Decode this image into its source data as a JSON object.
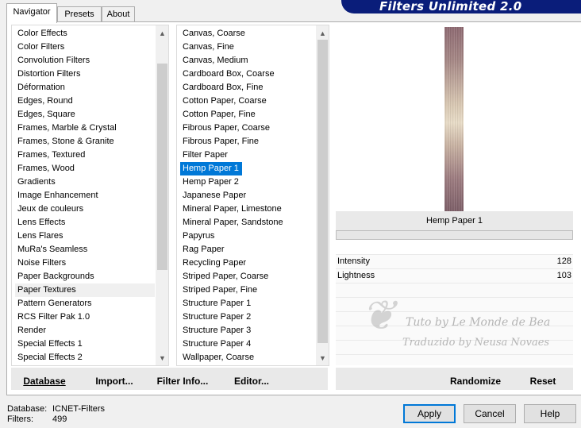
{
  "banner_title": "Filters Unlimited 2.0",
  "tabs": [
    {
      "label": "Navigator",
      "active": true
    },
    {
      "label": "Presets",
      "active": false
    },
    {
      "label": "About",
      "active": false
    }
  ],
  "categories": [
    "Color Effects",
    "Color Filters",
    "Convolution Filters",
    "Distortion Filters",
    "Déformation",
    "Edges, Round",
    "Edges, Square",
    "Frames, Marble & Crystal",
    "Frames, Stone & Granite",
    "Frames, Textured",
    "Frames, Wood",
    "Gradients",
    "Image Enhancement",
    "Jeux de couleurs",
    "Lens Effects",
    "Lens Flares",
    "MuRa's Seamless",
    "Noise Filters",
    "Paper Backgrounds",
    "Paper Textures",
    "Pattern Generators",
    "RCS Filter Pak 1.0",
    "Render",
    "Special Effects 1",
    "Special Effects 2"
  ],
  "categories_selected": "Paper Textures",
  "filters": [
    "Canvas, Coarse",
    "Canvas, Fine",
    "Canvas, Medium",
    "Cardboard Box, Coarse",
    "Cardboard Box, Fine",
    "Cotton Paper, Coarse",
    "Cotton Paper, Fine",
    "Fibrous Paper, Coarse",
    "Fibrous Paper, Fine",
    "Filter Paper",
    "Hemp Paper 1",
    "Hemp Paper 2",
    "Japanese Paper",
    "Mineral Paper, Limestone",
    "Mineral Paper, Sandstone",
    "Papyrus",
    "Rag Paper",
    "Recycling Paper",
    "Striped Paper, Coarse",
    "Striped Paper, Fine",
    "Structure Paper 1",
    "Structure Paper 2",
    "Structure Paper 3",
    "Structure Paper 4",
    "Wallpaper, Coarse"
  ],
  "filters_selected": "Hemp Paper 1",
  "bottom_buttons": {
    "database": "Database",
    "import": "Import...",
    "filter_info": "Filter Info...",
    "editor": "Editor..."
  },
  "preview": {
    "filter_name": "Hemp Paper 1"
  },
  "params": [
    {
      "name": "Intensity",
      "value": "128"
    },
    {
      "name": "Lightness",
      "value": "103"
    }
  ],
  "right_buttons": {
    "randomize": "Randomize",
    "reset": "Reset"
  },
  "watermark": {
    "line1": "Tuto by Le Monde de Bea",
    "line2": "Traduzido by Neusa Novaes"
  },
  "status": {
    "database_label": "Database:",
    "database_value": "ICNET-Filters",
    "filters_label": "Filters:",
    "filters_value": "499"
  },
  "dialog_buttons": {
    "apply": "Apply",
    "cancel": "Cancel",
    "help": "Help"
  },
  "colors": {
    "selection": "#0078d7",
    "banner": "#0a1d7a"
  }
}
